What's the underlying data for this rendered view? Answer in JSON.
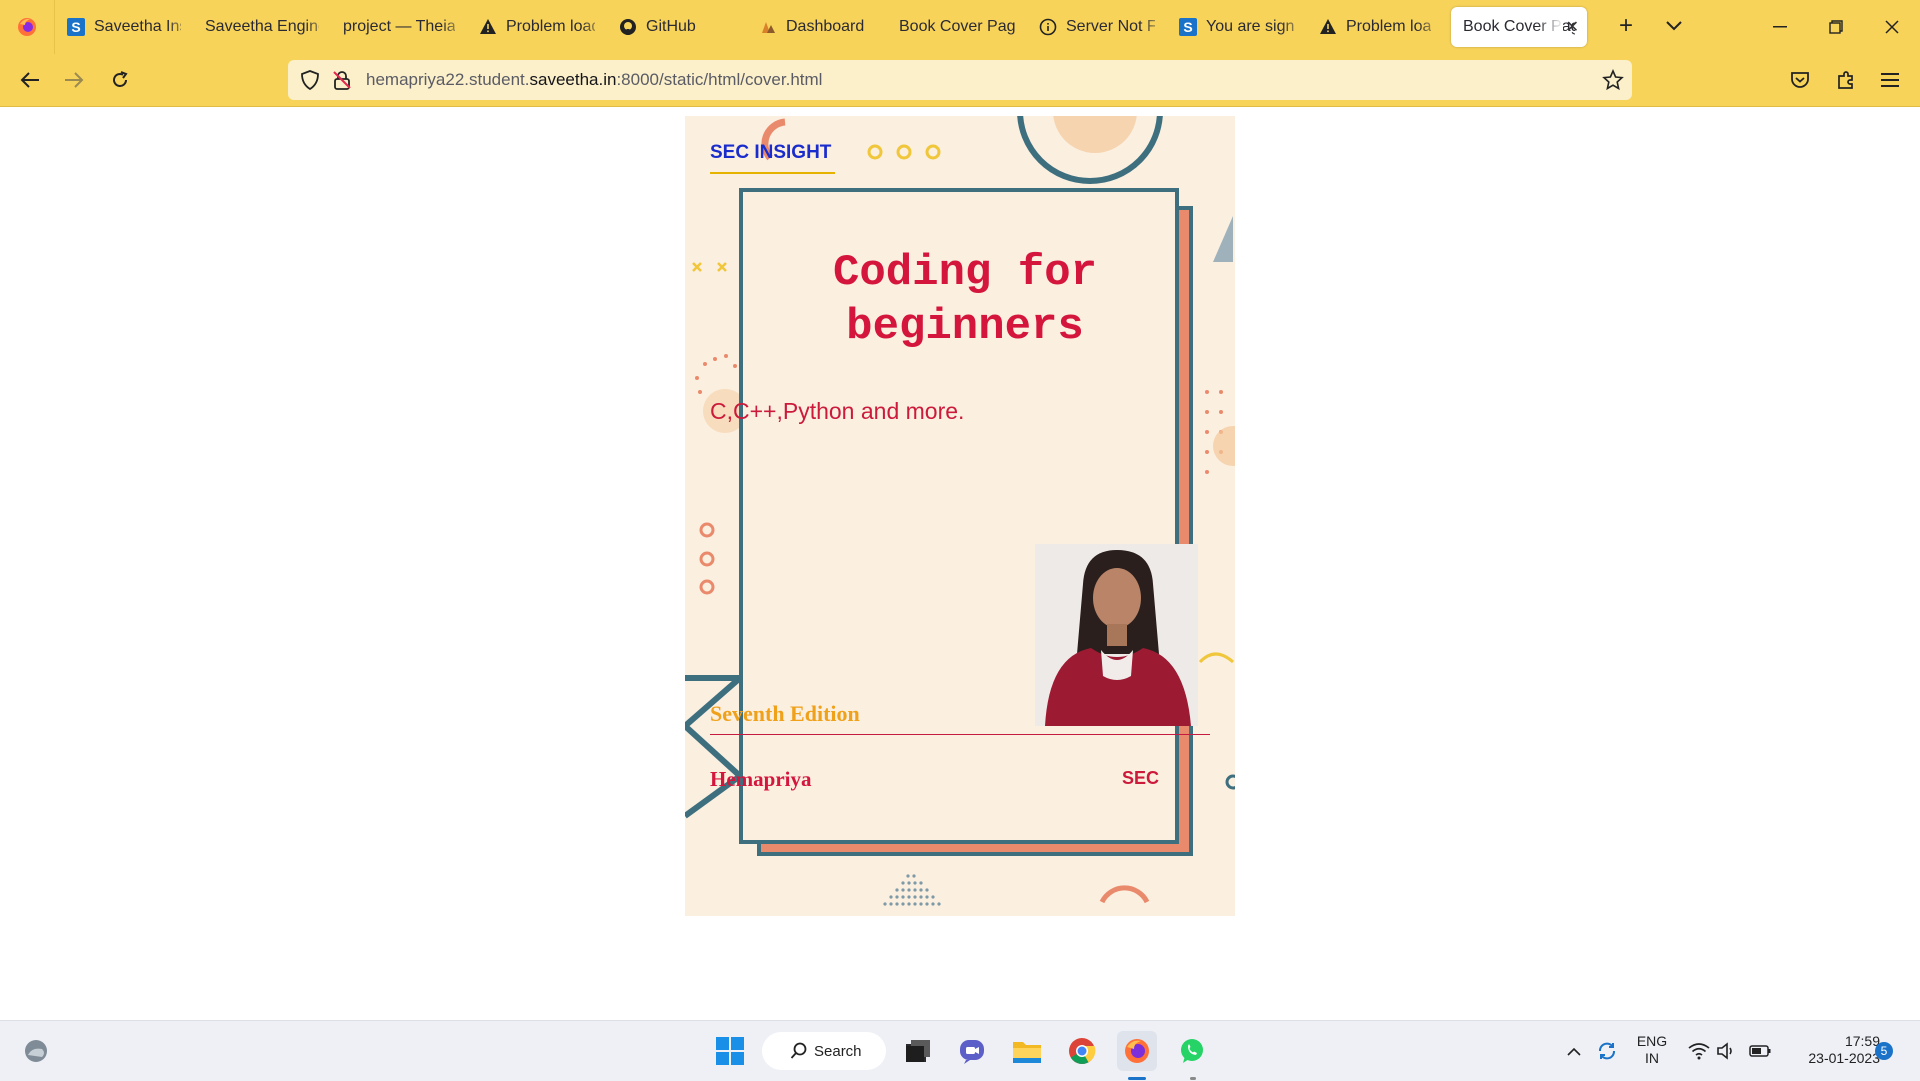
{
  "browser": {
    "tabs": [
      {
        "label": "Saveetha Institute",
        "icon": "saveetha-icon"
      },
      {
        "label": "Saveetha Engineering",
        "icon": "none"
      },
      {
        "label": "project — Theia",
        "icon": "none"
      },
      {
        "label": "Problem loading",
        "icon": "warning-icon"
      },
      {
        "label": "GitHub",
        "icon": "github-icon"
      },
      {
        "label": "Dashboard",
        "icon": "dashboard-icon"
      },
      {
        "label": "Book Cover Page",
        "icon": "none"
      },
      {
        "label": "Server Not Found",
        "icon": "info-icon"
      },
      {
        "label": "You are signed",
        "icon": "saveetha-icon"
      },
      {
        "label": "Problem loading",
        "icon": "warning-icon"
      },
      {
        "label": "Book Cover Page",
        "icon": "none",
        "active": true
      }
    ],
    "url_prefix": "hemapriya22.student.",
    "url_domain": "saveetha.in",
    "url_suffix": ":8000/static/html/cover.html"
  },
  "cover": {
    "brand": "SEC INSIGHT",
    "title_line1": "Coding for",
    "title_line2": "beginners",
    "subtitle": "C,C++,Python and more.",
    "edition": "Seventh Edition",
    "author": "Hemapriya",
    "publisher": "SEC"
  },
  "taskbar": {
    "search_label": "Search",
    "language_line1": "ENG",
    "language_line2": "IN",
    "time": "17:59",
    "date": "23-01-2023",
    "notification_count": "5"
  },
  "colors": {
    "chrome": "#f7d35a",
    "cover_bg": "#fbefe0",
    "frame": "#3e6f7f",
    "title": "#d4163c",
    "edition": "#f0a11a",
    "brand": "#1a2dcc"
  }
}
